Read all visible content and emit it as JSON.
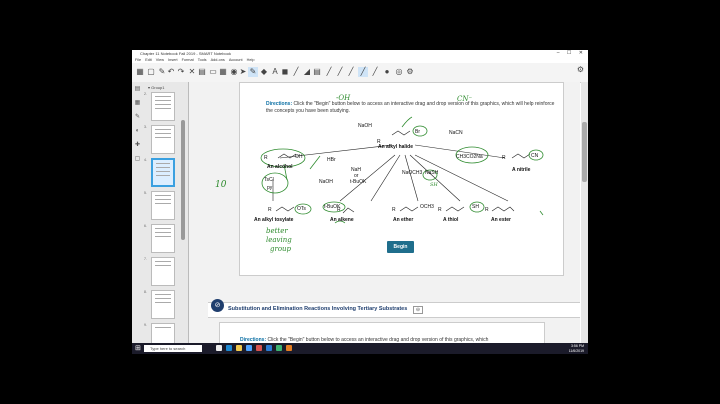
{
  "window": {
    "title": "Chapter 11 Notebook Fall 2019 - SMART Notebook",
    "controls": "– ☐ ✕"
  },
  "menu": [
    "File",
    "Edit",
    "View",
    "Insert",
    "Format",
    "Tools",
    "Add-ons",
    "Account",
    "Help"
  ],
  "sidebar": {
    "group_label": "▾ Group1",
    "pages": [
      {
        "n": "2."
      },
      {
        "n": "3."
      },
      {
        "n": "4."
      },
      {
        "n": "5."
      },
      {
        "n": "6."
      },
      {
        "n": "7."
      },
      {
        "n": "8."
      },
      {
        "n": "9."
      },
      {
        "n": "10."
      },
      {
        "n": "11."
      }
    ]
  },
  "content": {
    "directions_label": "Directions:",
    "directions_text": " Click the \"Begin\" button below to access an interactive drag and drop version of this graphics, which will help reinforce the concepts you have been studying.",
    "begin_label": "Begin",
    "labels": {
      "naoh_top": "NaOH",
      "alkyl_halide": "An alkyl halide",
      "nacn": "NaCN",
      "hbr": "HBr",
      "alcohol": "An alcohol",
      "nitrile": "A nitrile",
      "tscl": "TsCl",
      "py": "py",
      "naoh_mid": "NaOH",
      "nah": "NaH",
      "or": "or",
      "tbuok": "t-BuOK",
      "naoch3": "NaOCH3",
      "nash": "NaSH",
      "ch3co2na": "CH3CO2Na",
      "tosylate": "An alkyl tosylate",
      "alkene": "An alkene",
      "ether": "An ether",
      "thiol": "A thiol",
      "ester": "An ester",
      "br": "Br",
      "oh": "OH",
      "cn": "CN",
      "ots": "OTs",
      "sh": "SH",
      "och3": "OCH3",
      "r": "R"
    },
    "handwriting": {
      "oh_minus": "-OH",
      "cn_minus": "CN⁻",
      "ten": "10",
      "better_leaving_group": [
        "better",
        "leaving",
        "group"
      ],
      "tbuok_circle": "t-BuOK",
      "sh_minus": "SH"
    }
  },
  "section2": {
    "title": "Substitution and Elimination Reactions Involving Tertiary Substrates",
    "collapse": "⊖",
    "directions_label": "Directions:",
    "directions_text": " Click the \"Begin\" button below to access an interactive drag and drop version of this graphics, which"
  },
  "taskbar": {
    "search_placeholder": "Type here to search",
    "time": "3:56 PM",
    "date": "11/6/2019"
  },
  "colors": {
    "ink": "#2e8b2e",
    "begin_button": "#1f6e8c",
    "directions": "#0b6fa4"
  }
}
